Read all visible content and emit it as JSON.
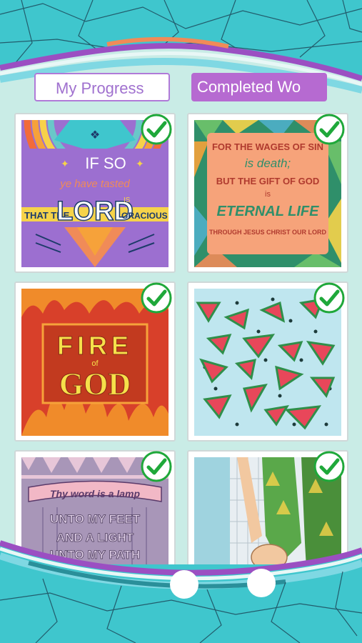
{
  "tabs": {
    "my_progress": "My Progress",
    "completed": "Completed Wo"
  },
  "colors": {
    "background": "#3fc6cd",
    "accent_purple": "#b66ad1",
    "content_bg": "#c9ece6",
    "check_green": "#1fa83a"
  },
  "artworks": [
    {
      "text1": "IF SO",
      "text2": "ye have tasted",
      "text3": "THAT THE",
      "text4": "LORD",
      "text5": "IS",
      "text6": "GRACIOUS",
      "completed": "checkmark-icon"
    },
    {
      "line1": "FOR THE WAGES OF SIN",
      "line2": "is death;",
      "line3": "BUT THE GIFT OF GOD",
      "line4": "is",
      "line5": "ETERNAL LIFE",
      "line6": "THROUGH JESUS CHRIST OUR LORD",
      "completed": "checkmark-icon"
    },
    {
      "line1": "FIRE",
      "line2": "of",
      "line3": "GOD",
      "completed": "checkmark-icon"
    },
    {
      "completed": "checkmark-icon"
    },
    {
      "line1": "Thy word is a lamp",
      "line2": "UNTO MY FEET",
      "line3": "AND A LIGHT",
      "line4": "UNTO MY PATH",
      "completed": "checkmark-icon"
    },
    {
      "completed": "checkmark-icon"
    }
  ]
}
